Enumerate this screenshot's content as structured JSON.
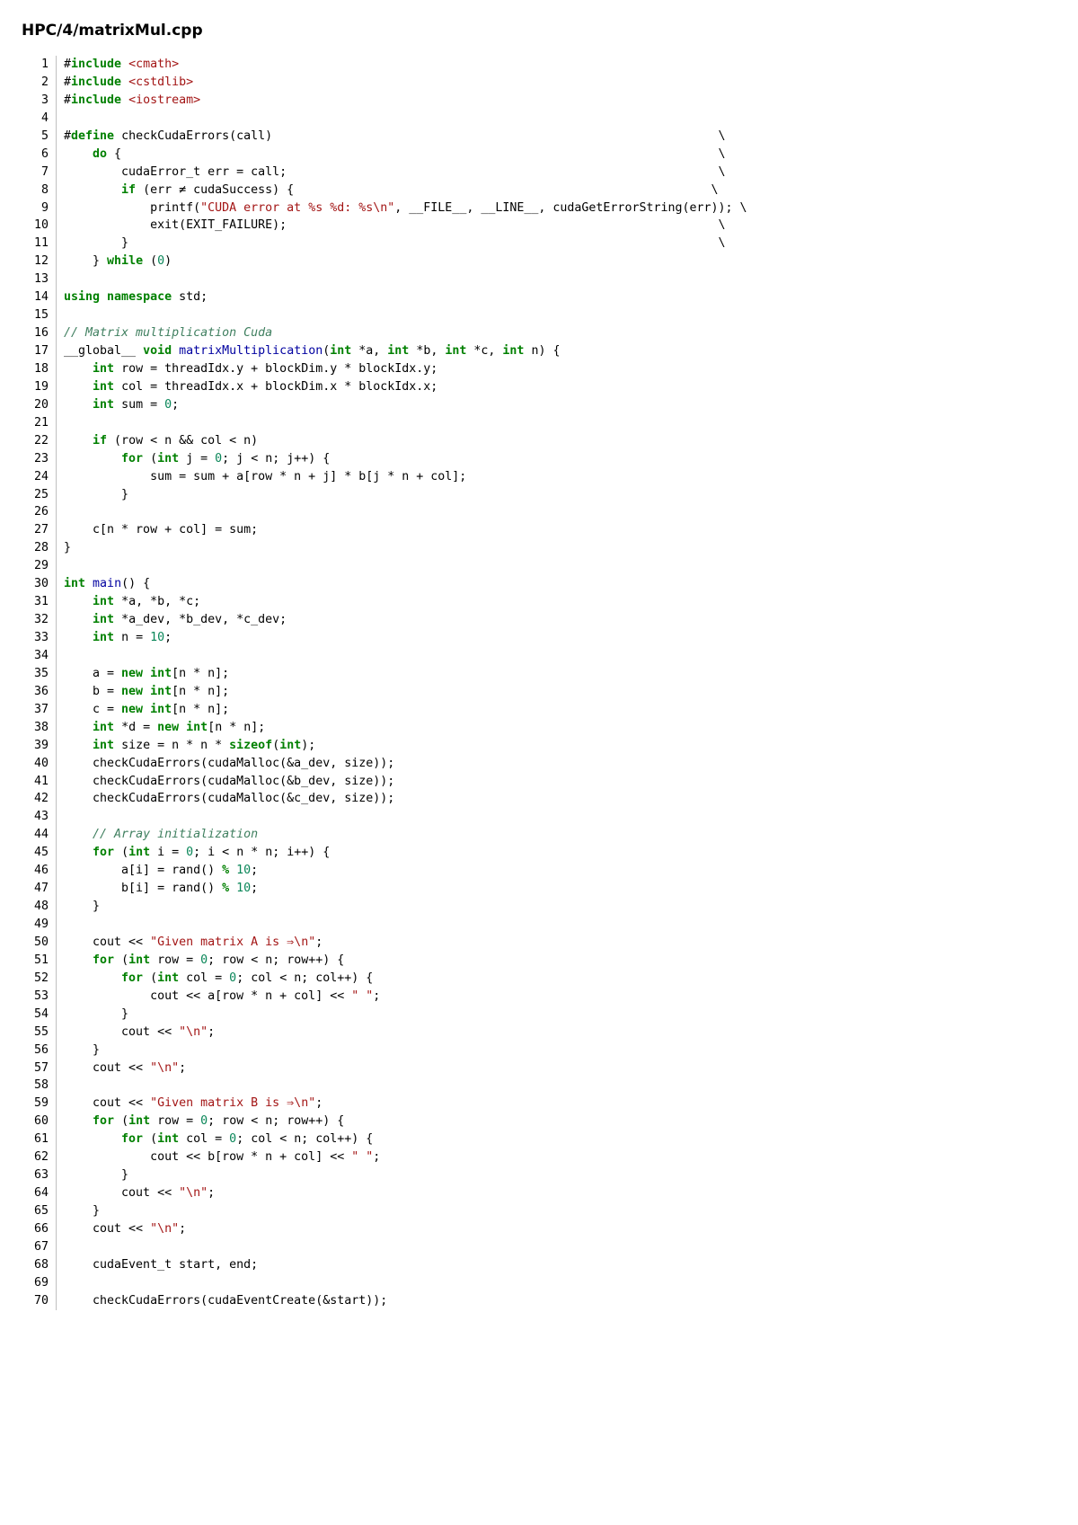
{
  "title": "HPC/4/matrixMul.cpp",
  "lines": [
    {
      "n": 1,
      "html": "#<span class='kw'>include</span> <span class='s'>&lt;cmath&gt;</span>"
    },
    {
      "n": 2,
      "html": "#<span class='kw'>include</span> <span class='s'>&lt;cstdlib&gt;</span>"
    },
    {
      "n": 3,
      "html": "#<span class='kw'>include</span> <span class='s'>&lt;iostream&gt;</span>"
    },
    {
      "n": 4,
      "html": ""
    },
    {
      "n": 5,
      "html": "#<span class='kw'>define</span> checkCudaErrors(call)                                                              \\"
    },
    {
      "n": 6,
      "html": "    <span class='kw'>do</span> {                                                                                   \\"
    },
    {
      "n": 7,
      "html": "        cudaError_t err = call;                                                            \\"
    },
    {
      "n": 8,
      "html": "        <span class='kw'>if</span> (err &#8800; cudaSuccess) {                                                          \\"
    },
    {
      "n": 9,
      "html": "            printf(<span class='s'>\"CUDA error at %s %d: %s\\n\"</span>, __FILE__, __LINE__, cudaGetErrorString(err)); \\"
    },
    {
      "n": 10,
      "html": "            exit(EXIT_FAILURE);                                                            \\"
    },
    {
      "n": 11,
      "html": "        }                                                                                  \\"
    },
    {
      "n": 12,
      "html": "    } <span class='kw'>while</span> (<span class='m'>0</span>)"
    },
    {
      "n": 13,
      "html": ""
    },
    {
      "n": 14,
      "html": "<span class='kw'>using</span> <span class='kw'>namespace</span> std;"
    },
    {
      "n": 15,
      "html": ""
    },
    {
      "n": 16,
      "html": "<span class='c1'>// Matrix multiplication Cuda</span>"
    },
    {
      "n": 17,
      "html": "__global__ <span class='kw'>void</span> <span class='fn'>matrixMultiplication</span>(<span class='kw'>int</span> *a, <span class='kw'>int</span> *b, <span class='kw'>int</span> *c, <span class='kw'>int</span> n) {"
    },
    {
      "n": 18,
      "html": "    <span class='kw'>int</span> row = threadIdx.y + blockDim.y * blockIdx.y;"
    },
    {
      "n": 19,
      "html": "    <span class='kw'>int</span> col = threadIdx.x + blockDim.x * blockIdx.x;"
    },
    {
      "n": 20,
      "html": "    <span class='kw'>int</span> sum = <span class='m'>0</span>;"
    },
    {
      "n": 21,
      "html": ""
    },
    {
      "n": 22,
      "html": "    <span class='kw'>if</span> (row &lt; n &amp;&amp; col &lt; n)"
    },
    {
      "n": 23,
      "html": "        <span class='kw'>for</span> (<span class='kw'>int</span> j = <span class='m'>0</span>; j &lt; n; j++) {"
    },
    {
      "n": 24,
      "html": "            sum = sum + a[row * n + j] * b[j * n + col];"
    },
    {
      "n": 25,
      "html": "        }"
    },
    {
      "n": 26,
      "html": ""
    },
    {
      "n": 27,
      "html": "    c[n * row + col] = sum;"
    },
    {
      "n": 28,
      "html": "}"
    },
    {
      "n": 29,
      "html": ""
    },
    {
      "n": 30,
      "html": "<span class='kw'>int</span> <span class='fn'>main</span>() {"
    },
    {
      "n": 31,
      "html": "    <span class='kw'>int</span> *a, *b, *c;"
    },
    {
      "n": 32,
      "html": "    <span class='kw'>int</span> *a_dev, *b_dev, *c_dev;"
    },
    {
      "n": 33,
      "html": "    <span class='kw'>int</span> n = <span class='m'>10</span>;"
    },
    {
      "n": 34,
      "html": ""
    },
    {
      "n": 35,
      "html": "    a = <span class='kw'>new</span> <span class='kw'>int</span>[n * n];"
    },
    {
      "n": 36,
      "html": "    b = <span class='kw'>new</span> <span class='kw'>int</span>[n * n];"
    },
    {
      "n": 37,
      "html": "    c = <span class='kw'>new</span> <span class='kw'>int</span>[n * n];"
    },
    {
      "n": 38,
      "html": "    <span class='kw'>int</span> *d = <span class='kw'>new</span> <span class='kw'>int</span>[n * n];"
    },
    {
      "n": 39,
      "html": "    <span class='kw'>int</span> size = n * n * <span class='kw'>sizeof</span>(<span class='kw'>int</span>);"
    },
    {
      "n": 40,
      "html": "    checkCudaErrors(cudaMalloc(&amp;a_dev, size));"
    },
    {
      "n": 41,
      "html": "    checkCudaErrors(cudaMalloc(&amp;b_dev, size));"
    },
    {
      "n": 42,
      "html": "    checkCudaErrors(cudaMalloc(&amp;c_dev, size));"
    },
    {
      "n": 43,
      "html": ""
    },
    {
      "n": 44,
      "html": "    <span class='c1'>// Array initialization</span>"
    },
    {
      "n": 45,
      "html": "    <span class='kw'>for</span> (<span class='kw'>int</span> i = <span class='m'>0</span>; i &lt; n * n; i++) {"
    },
    {
      "n": 46,
      "html": "        a[i] = rand() <span class='kw'>%</span> <span class='m'>10</span>;"
    },
    {
      "n": 47,
      "html": "        b[i] = rand() <span class='kw'>%</span> <span class='m'>10</span>;"
    },
    {
      "n": 48,
      "html": "    }"
    },
    {
      "n": 49,
      "html": ""
    },
    {
      "n": 50,
      "html": "    cout &lt;&lt; <span class='s'>\"Given matrix A is &#8658;\\n\"</span>;"
    },
    {
      "n": 51,
      "html": "    <span class='kw'>for</span> (<span class='kw'>int</span> row = <span class='m'>0</span>; row &lt; n; row++) {"
    },
    {
      "n": 52,
      "html": "        <span class='kw'>for</span> (<span class='kw'>int</span> col = <span class='m'>0</span>; col &lt; n; col++) {"
    },
    {
      "n": 53,
      "html": "            cout &lt;&lt; a[row * n + col] &lt;&lt; <span class='s'>\" \"</span>;"
    },
    {
      "n": 54,
      "html": "        }"
    },
    {
      "n": 55,
      "html": "        cout &lt;&lt; <span class='s'>\"\\n\"</span>;"
    },
    {
      "n": 56,
      "html": "    }"
    },
    {
      "n": 57,
      "html": "    cout &lt;&lt; <span class='s'>\"\\n\"</span>;"
    },
    {
      "n": 58,
      "html": ""
    },
    {
      "n": 59,
      "html": "    cout &lt;&lt; <span class='s'>\"Given matrix B is &#8658;\\n\"</span>;"
    },
    {
      "n": 60,
      "html": "    <span class='kw'>for</span> (<span class='kw'>int</span> row = <span class='m'>0</span>; row &lt; n; row++) {"
    },
    {
      "n": 61,
      "html": "        <span class='kw'>for</span> (<span class='kw'>int</span> col = <span class='m'>0</span>; col &lt; n; col++) {"
    },
    {
      "n": 62,
      "html": "            cout &lt;&lt; b[row * n + col] &lt;&lt; <span class='s'>\" \"</span>;"
    },
    {
      "n": 63,
      "html": "        }"
    },
    {
      "n": 64,
      "html": "        cout &lt;&lt; <span class='s'>\"\\n\"</span>;"
    },
    {
      "n": 65,
      "html": "    }"
    },
    {
      "n": 66,
      "html": "    cout &lt;&lt; <span class='s'>\"\\n\"</span>;"
    },
    {
      "n": 67,
      "html": ""
    },
    {
      "n": 68,
      "html": "    cudaEvent_t start, end;"
    },
    {
      "n": 69,
      "html": ""
    },
    {
      "n": 70,
      "html": "    checkCudaErrors(cudaEventCreate(&amp;start));"
    }
  ]
}
